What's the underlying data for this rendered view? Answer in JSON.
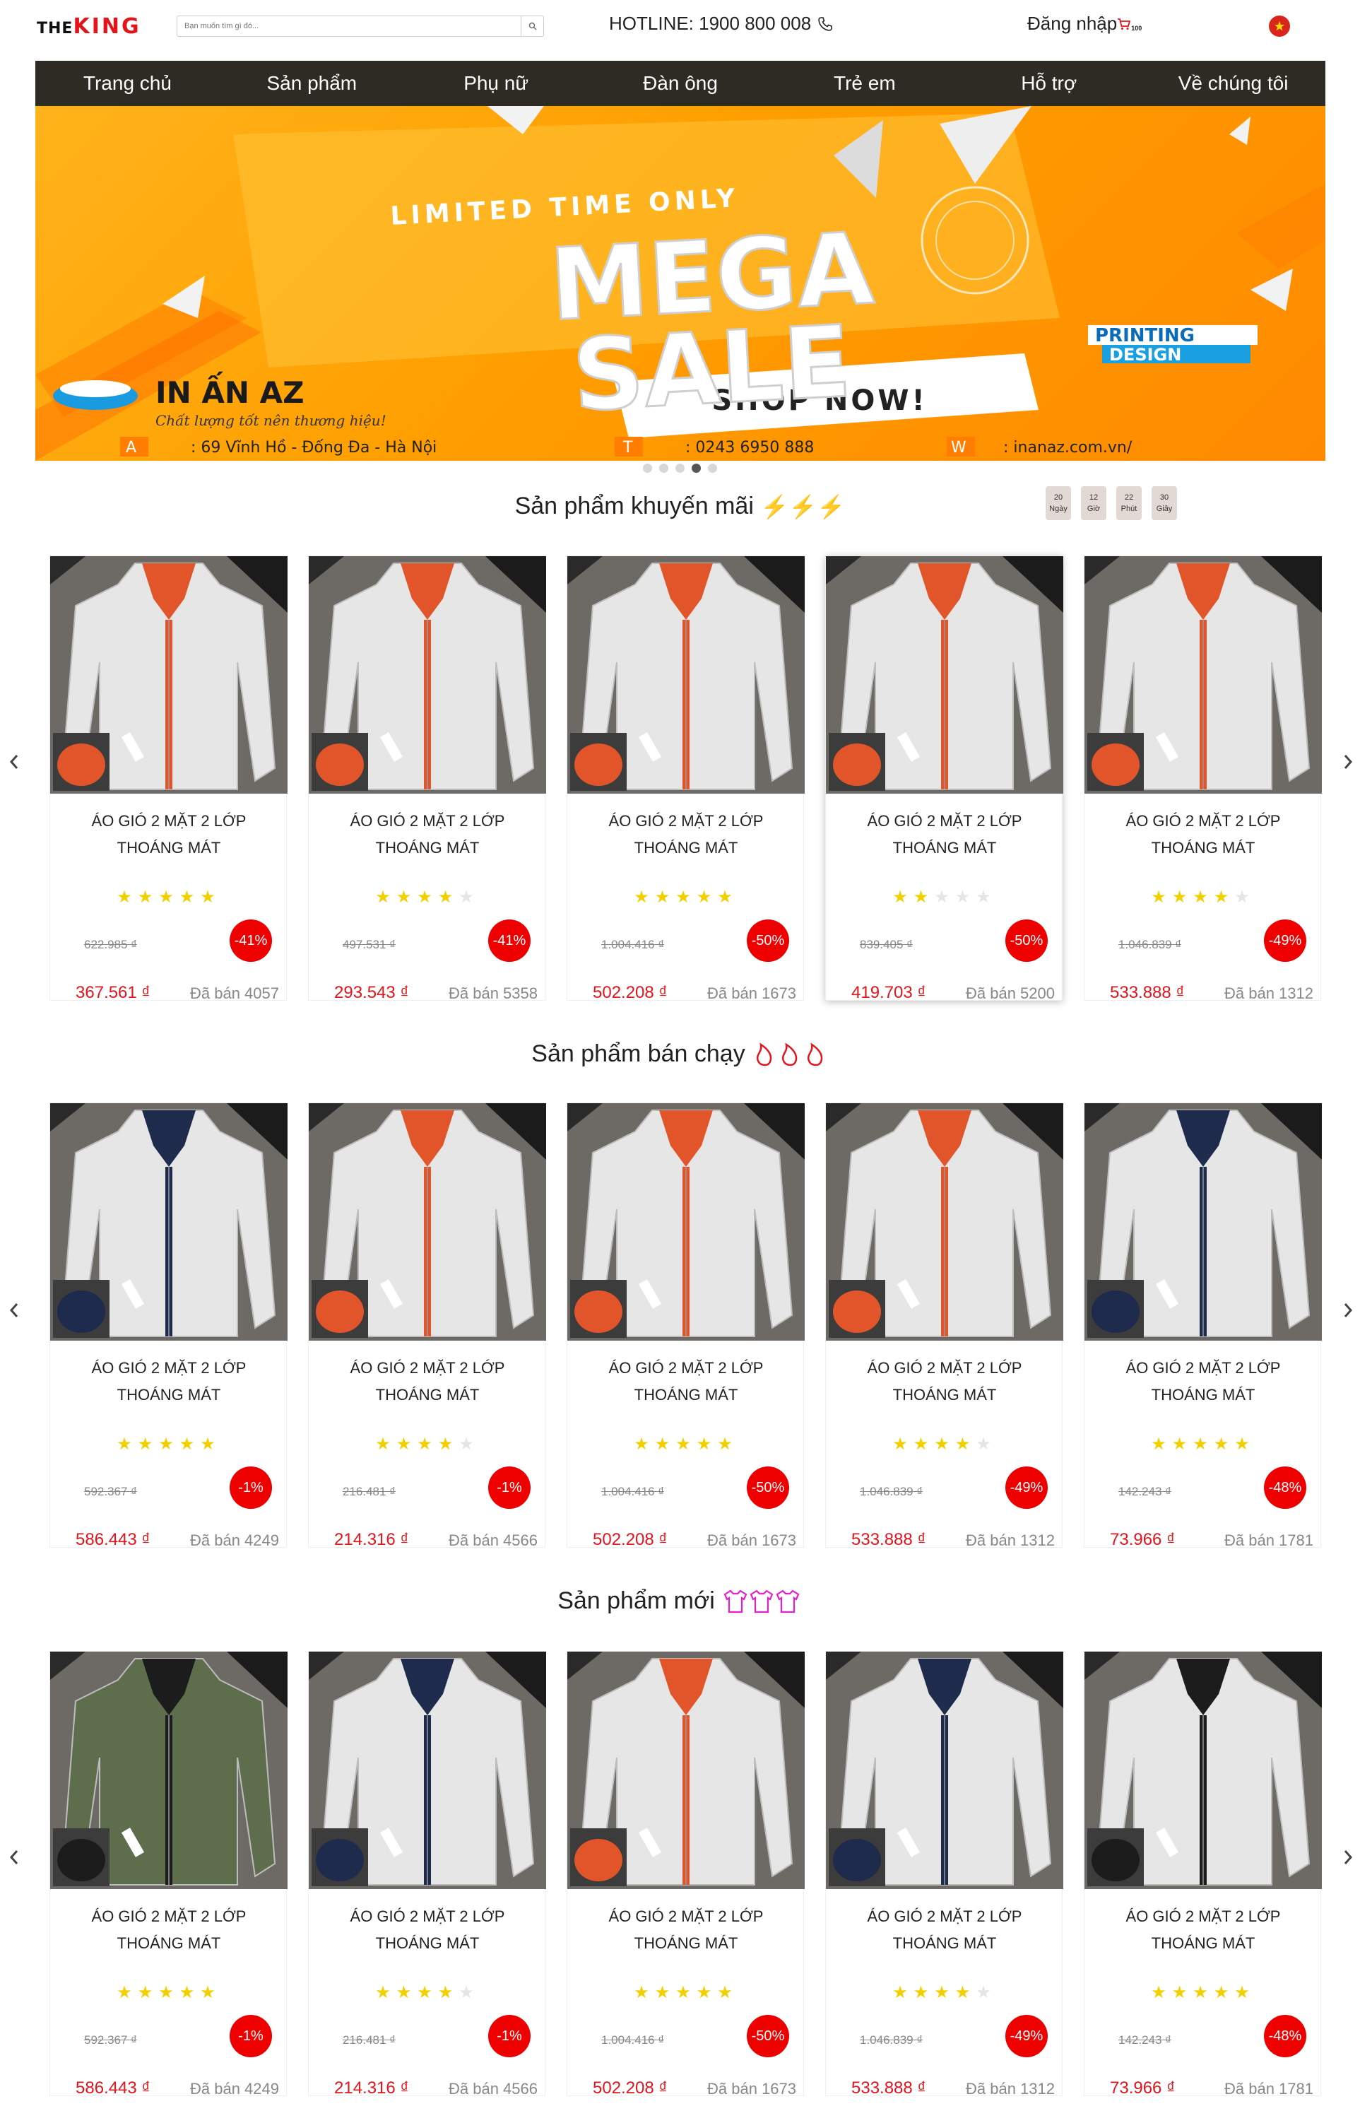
{
  "header": {
    "logo_part1": "THE",
    "logo_part2": "KING",
    "search_placeholder": "Bạn muốn tìm gì đó...",
    "hotline": "HOTLINE: 1900 800 008",
    "login": "Đăng nhập",
    "cart_count": "100"
  },
  "nav": [
    "Trang chủ",
    "Sản phẩm",
    "Phụ nữ",
    "Đàn ông",
    "Trẻ em",
    "Hỗ trợ",
    "Về chúng tôi"
  ],
  "banner": {
    "line1": "LIMITED TIME ONLY",
    "line2": "MEGA",
    "line3": "SALE",
    "cta": "SHOP NOW!",
    "brand": "IN ẤN AZ",
    "tagline": "Chất lượng tốt nên thương hiệu!",
    "badge1": "PRINTING",
    "badge2": "DESIGN",
    "address_label": "A",
    "address": ": 69 Vĩnh Hồ - Đống Đa - Hà Nội",
    "tel_label": "T",
    "tel": ": 0243 6950 888",
    "web_label": "W",
    "web": ": inanaz.com.vn/",
    "slides": 5,
    "active_slide": 4
  },
  "sections": [
    {
      "title": "Sản phẩm khuyến mãi",
      "emoji": "⚡⚡⚡",
      "countdown": [
        {
          "value": "20",
          "label": "Ngày"
        },
        {
          "value": "12",
          "label": "Giờ"
        },
        {
          "value": "22",
          "label": "Phút"
        },
        {
          "value": "30",
          "label": "Giây"
        }
      ],
      "products": [
        {
          "name1": "ÁO GIÓ 2 MẶT 2 LỚP",
          "name2": "THOÁNG MÁT",
          "rating": 5,
          "old_price": "622.985 ₫",
          "discount": "-41%",
          "price": "367.561 ₫",
          "sold": "Đã bán 4057",
          "inner": "orange",
          "jacket": "white"
        },
        {
          "name1": "ÁO GIÓ 2 MẶT 2 LỚP",
          "name2": "THOÁNG MÁT",
          "rating": 4,
          "old_price": "497.531 ₫",
          "discount": "-41%",
          "price": "293.543 ₫",
          "sold": "Đã bán 5358",
          "inner": "orange",
          "jacket": "white"
        },
        {
          "name1": "ÁO GIÓ 2 MẶT 2 LỚP",
          "name2": "THOÁNG MÁT",
          "rating": 5,
          "old_price": "1.004.416 ₫",
          "discount": "-50%",
          "price": "502.208 ₫",
          "sold": "Đã bán 1673",
          "inner": "orange",
          "jacket": "white"
        },
        {
          "name1": "ÁO GIÓ 2 MẶT 2 LỚP",
          "name2": "THOÁNG MÁT",
          "rating": 2,
          "old_price": "839.405 ₫",
          "discount": "-50%",
          "price": "419.703 ₫",
          "sold": "Đã bán 5200",
          "inner": "orange",
          "jacket": "white"
        },
        {
          "name1": "ÁO GIÓ 2 MẶT 2 LỚP",
          "name2": "THOÁNG MÁT",
          "rating": 4,
          "old_price": "1.046.839 ₫",
          "discount": "-49%",
          "price": "533.888 ₫",
          "sold": "Đã bán 1312",
          "inner": "orange",
          "jacket": "white"
        }
      ]
    },
    {
      "title": "Sản phẩm bán chạy",
      "emoji": "",
      "products": [
        {
          "name1": "ÁO GIÓ 2 MẶT 2 LỚP",
          "name2": "THOÁNG MÁT",
          "rating": 5,
          "old_price": "592.367 ₫",
          "discount": "-1%",
          "price": "586.443 ₫",
          "sold": "Đã bán 4249",
          "inner": "navy",
          "jacket": "white"
        },
        {
          "name1": "ÁO GIÓ 2 MẶT 2 LỚP",
          "name2": "THOÁNG MÁT",
          "rating": 4,
          "old_price": "216.481 ₫",
          "discount": "-1%",
          "price": "214.316 ₫",
          "sold": "Đã bán 4566",
          "inner": "orange",
          "jacket": "white"
        },
        {
          "name1": "ÁO GIÓ 2 MẶT 2 LỚP",
          "name2": "THOÁNG MÁT",
          "rating": 5,
          "old_price": "1.004.416 ₫",
          "discount": "-50%",
          "price": "502.208 ₫",
          "sold": "Đã bán 1673",
          "inner": "orange",
          "jacket": "white"
        },
        {
          "name1": "ÁO GIÓ 2 MẶT 2 LỚP",
          "name2": "THOÁNG MÁT",
          "rating": 4,
          "old_price": "1.046.839 ₫",
          "discount": "-49%",
          "price": "533.888 ₫",
          "sold": "Đã bán 1312",
          "inner": "orange",
          "jacket": "white"
        },
        {
          "name1": "ÁO GIÓ 2 MẶT 2 LỚP",
          "name2": "THOÁNG MÁT",
          "rating": 5,
          "old_price": "142.243 ₫",
          "discount": "-48%",
          "price": "73.966 ₫",
          "sold": "Đã bán 1781",
          "inner": "navy",
          "jacket": "white"
        }
      ]
    },
    {
      "title": "Sản phẩm mới",
      "emoji": "",
      "products": [
        {
          "name1": "ÁO GIÓ 2 MẶT 2 LỚP",
          "name2": "THOÁNG MÁT",
          "rating": 5,
          "old_price": "592.367 ₫",
          "discount": "-1%",
          "price": "586.443 ₫",
          "sold": "Đã bán 4249",
          "inner": "black",
          "jacket": "green"
        },
        {
          "name1": "ÁO GIÓ 2 MẶT 2 LỚP",
          "name2": "THOÁNG MÁT",
          "rating": 4,
          "old_price": "216.481 ₫",
          "discount": "-1%",
          "price": "214.316 ₫",
          "sold": "Đã bán 4566",
          "inner": "navy",
          "jacket": "white"
        },
        {
          "name1": "ÁO GIÓ 2 MẶT 2 LỚP",
          "name2": "THOÁNG MÁT",
          "rating": 5,
          "old_price": "1.004.416 ₫",
          "discount": "-50%",
          "price": "502.208 ₫",
          "sold": "Đã bán 1673",
          "inner": "orange",
          "jacket": "white"
        },
        {
          "name1": "ÁO GIÓ 2 MẶT 2 LỚP",
          "name2": "THOÁNG MÁT",
          "rating": 4,
          "old_price": "1.046.839 ₫",
          "discount": "-49%",
          "price": "533.888 ₫",
          "sold": "Đã bán 1312",
          "inner": "navy",
          "jacket": "white"
        },
        {
          "name1": "ÁO GIÓ 2 MẶT 2 LỚP",
          "name2": "THOÁNG MÁT",
          "rating": 5,
          "old_price": "142.243 ₫",
          "discount": "-48%",
          "price": "73.966 ₫",
          "sold": "Đã bán 1781",
          "inner": "black",
          "jacket": "white"
        }
      ]
    }
  ],
  "colors": {
    "brand_red": "#e4141b",
    "nav_bg": "#2e2a24",
    "discount_bg": "#ee0000",
    "star": "#f2d000",
    "banner_orange": "#ff9e00"
  }
}
